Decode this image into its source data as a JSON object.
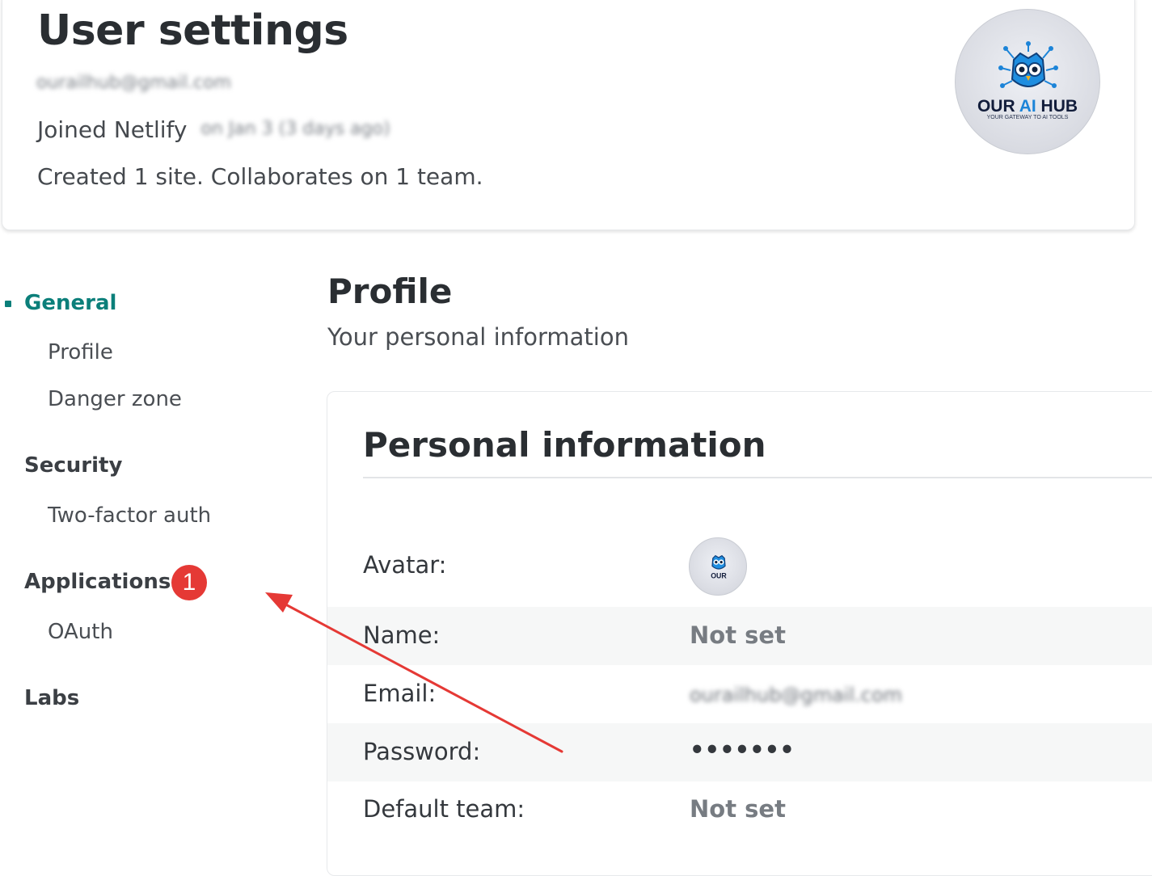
{
  "header": {
    "title": "User settings",
    "email_blurred": "ourailhub@gmail.com",
    "joined_prefix": "Joined Netlify",
    "joined_date_blurred": "on Jan 3 (3 days ago)",
    "created_text": "Created 1 site. Collaborates on 1 team."
  },
  "logo": {
    "our": "OUR ",
    "ai": "AI",
    "hub": " HUB",
    "tagline": "YOUR GATEWAY TO AI TOOLS"
  },
  "sidebar": {
    "sections": [
      {
        "label": "General",
        "items": [
          "Profile",
          "Danger zone"
        ]
      },
      {
        "label": "Security",
        "items": [
          "Two-factor auth"
        ]
      },
      {
        "label": "Applications",
        "items": [
          "OAuth"
        ]
      },
      {
        "label": "Labs",
        "items": []
      }
    ],
    "badge": "1"
  },
  "profile": {
    "title": "Profile",
    "subtitle": "Your personal information"
  },
  "personal_info": {
    "title": "Personal information",
    "rows": [
      {
        "label": "Avatar:",
        "value": ""
      },
      {
        "label": "Name:",
        "value": "Not set"
      },
      {
        "label": "Email:",
        "value": "ourailhub@gmail.com"
      },
      {
        "label": "Password:",
        "value": "•••••••"
      },
      {
        "label": "Default team:",
        "value": "Not set"
      }
    ]
  },
  "colors": {
    "accent": "#0b7f7a",
    "badge": "#e53935",
    "arrow": "#e53935"
  }
}
